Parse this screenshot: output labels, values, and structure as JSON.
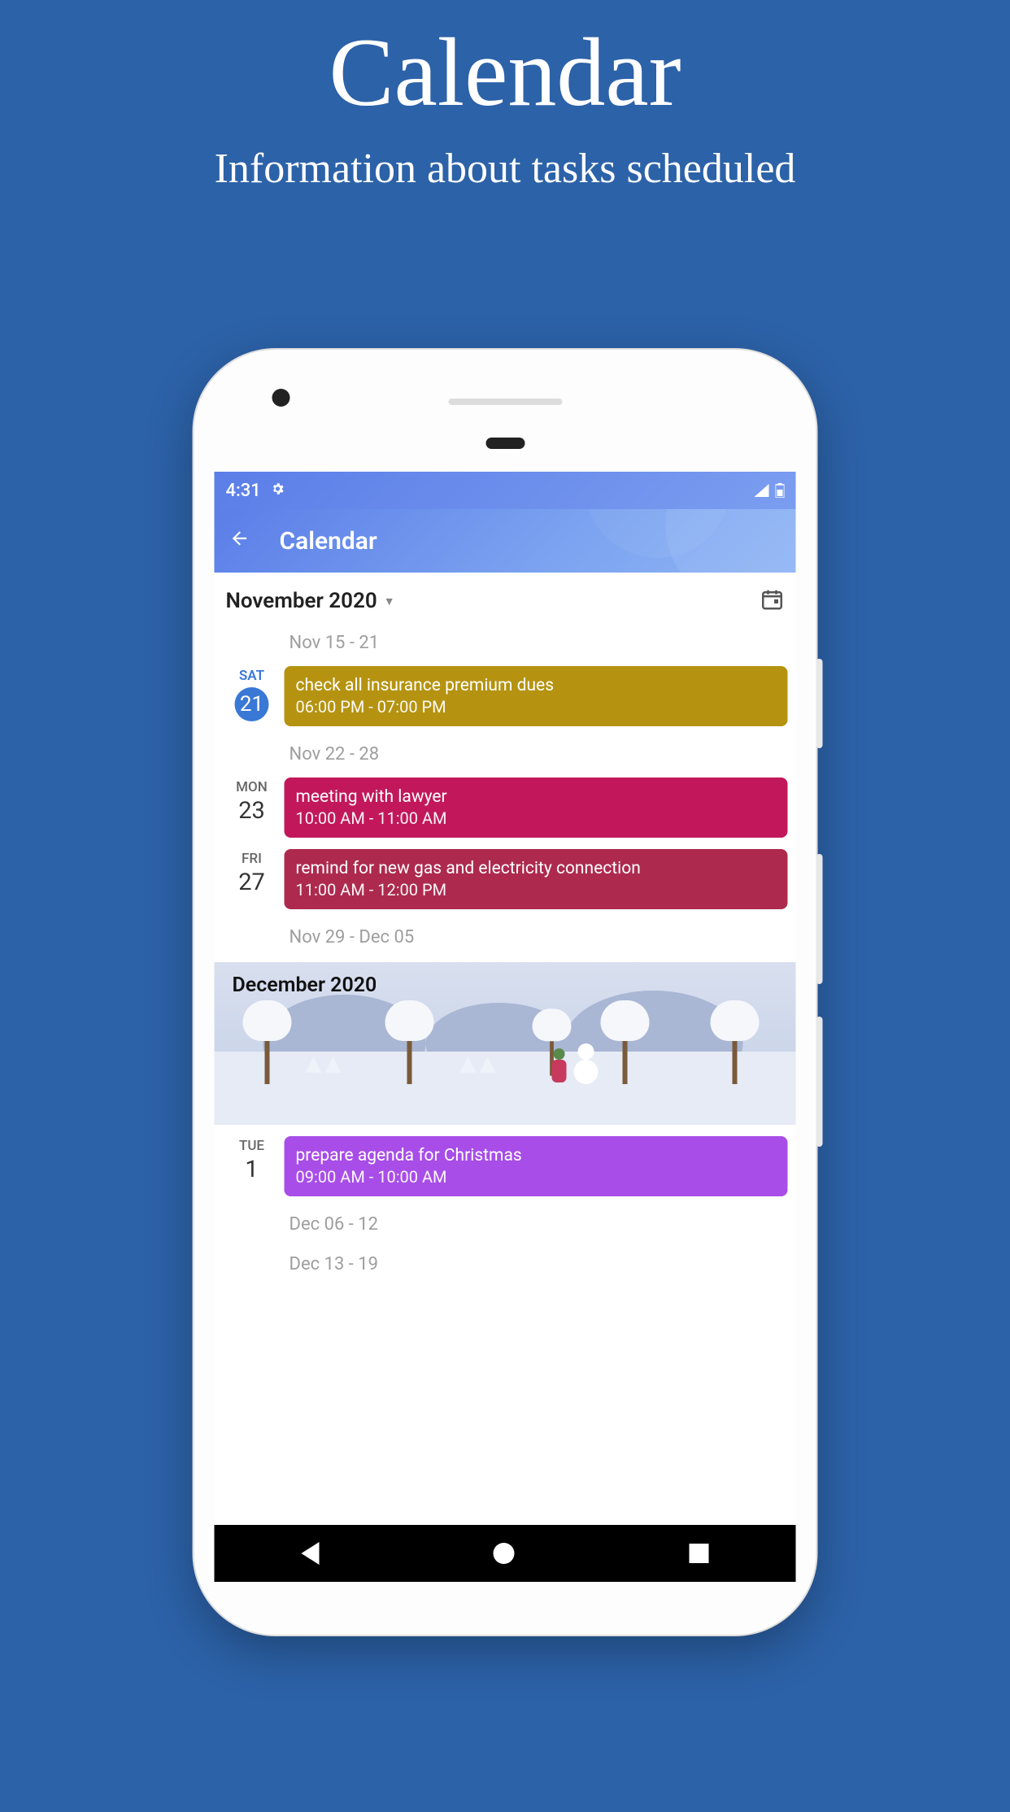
{
  "promo": {
    "title": "Calendar",
    "subtitle": "Information about tasks scheduled"
  },
  "status": {
    "time": "4:31"
  },
  "appbar": {
    "title": "Calendar"
  },
  "current_month": "November 2020",
  "weeks": [
    {
      "label": "Nov 15 - 21"
    },
    {
      "label": "Nov 22 - 28"
    },
    {
      "label": "Nov 29 - Dec 05"
    },
    {
      "label": "Dec 06 - 12"
    },
    {
      "label": "Dec 13 - 19"
    }
  ],
  "events": [
    {
      "dow": "SAT",
      "day": "21",
      "today": true,
      "title": "check all insurance premium dues",
      "time": "06:00 PM - 07:00 PM",
      "color": "ev-yellow"
    },
    {
      "dow": "MON",
      "day": "23",
      "today": false,
      "title": "meeting with lawyer",
      "time": "10:00 AM - 11:00 AM",
      "color": "ev-magenta"
    },
    {
      "dow": "FRI",
      "day": "27",
      "today": false,
      "title": "remind for new gas and electricity connection",
      "time": "11:00 AM - 12:00 PM",
      "color": "ev-crimson"
    },
    {
      "dow": "TUE",
      "day": "1",
      "today": false,
      "title": "prepare agenda for Christmas",
      "time": "09:00 AM - 10:00 AM",
      "color": "ev-purple"
    }
  ],
  "next_month_banner": "December 2020"
}
